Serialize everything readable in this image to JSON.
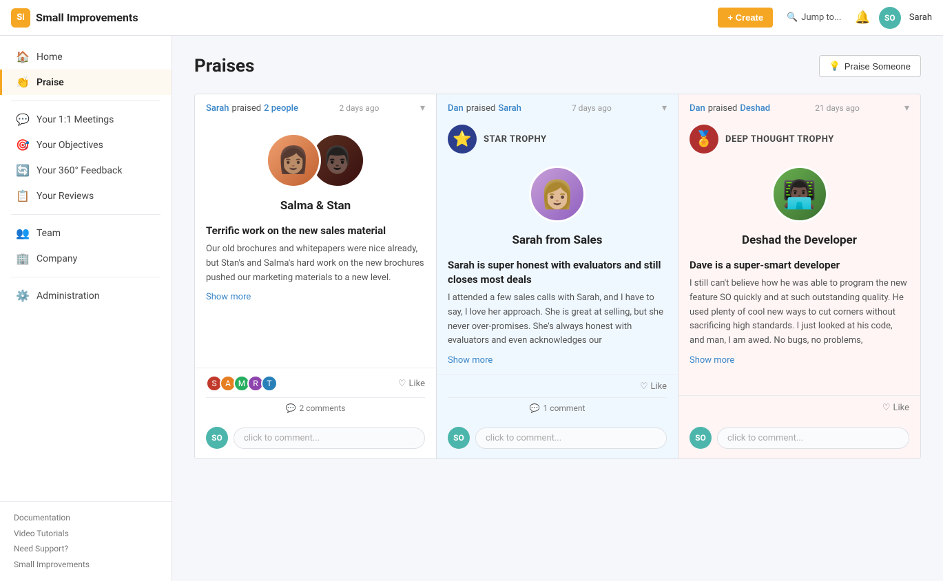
{
  "app": {
    "logo_text": "Si",
    "app_name": "Small Improvements"
  },
  "topnav": {
    "create_label": "+ Create",
    "jump_to_label": "Jump to...",
    "bell_label": "notifications",
    "user_initials": "SO",
    "user_name": "Sarah"
  },
  "sidebar": {
    "items": [
      {
        "id": "home",
        "label": "Home",
        "icon": "🏠",
        "active": false
      },
      {
        "id": "praise",
        "label": "Praise",
        "icon": "👏",
        "active": true
      },
      {
        "id": "meetings",
        "label": "Your 1:1 Meetings",
        "icon": "💬",
        "active": false
      },
      {
        "id": "objectives",
        "label": "Your Objectives",
        "icon": "🎯",
        "active": false
      },
      {
        "id": "feedback",
        "label": "Your 360° Feedback",
        "icon": "🔄",
        "active": false
      },
      {
        "id": "reviews",
        "label": "Your Reviews",
        "icon": "📋",
        "active": false
      },
      {
        "id": "team",
        "label": "Team",
        "icon": "👥",
        "active": false
      },
      {
        "id": "company",
        "label": "Company",
        "icon": "🏢",
        "active": false
      },
      {
        "id": "administration",
        "label": "Administration",
        "icon": "⚙️",
        "active": false
      }
    ],
    "footer_links": [
      "Documentation",
      "Video Tutorials",
      "Need Support?",
      "Small Improvements"
    ]
  },
  "page": {
    "title": "Praises",
    "praise_someone_label": "Praise Someone"
  },
  "cards": [
    {
      "id": "card1",
      "bg": "white",
      "by": "Sarah",
      "action": "praised",
      "target": "2 people",
      "time": "2 days ago",
      "trophy_type": "",
      "trophy_icon": "🏅",
      "trophy_label": "",
      "person_name": "Salma & Stan",
      "praise_title": "Terrific work on the new sales material",
      "praise_body": "Our old brochures and whitepapers were nice already, but Stan's and Salma's hard work on the new brochures pushed our marketing materials to a new level.",
      "show_more_label": "Show more",
      "reaction_avatars": [
        "av1",
        "av2",
        "av3",
        "av4",
        "av5"
      ],
      "like_label": "Like",
      "comments_count": "2 comments",
      "comment_placeholder": "click to comment...",
      "commenter_initials": "SO"
    },
    {
      "id": "card2",
      "bg": "blue",
      "by": "Dan",
      "action": "praised",
      "target": "Sarah",
      "time": "7 days ago",
      "trophy_type": "star",
      "trophy_icon": "⭐",
      "trophy_label": "STAR TROPHY",
      "person_name": "Sarah from Sales",
      "praise_title": "Sarah is super honest with evaluators and still closes most deals",
      "praise_body": "I attended a few sales calls with Sarah, and I have to say, I love her approach. She is great at selling, but she never over-promises. She's always honest with evaluators and even acknowledges our",
      "show_more_label": "Show more",
      "reaction_avatars": [],
      "like_label": "Like",
      "comments_count": "1 comment",
      "comment_placeholder": "click to comment...",
      "commenter_initials": "SO"
    },
    {
      "id": "card3",
      "bg": "pink",
      "by": "Dan",
      "action": "praised",
      "target": "Deshad",
      "time": "21 days ago",
      "trophy_type": "deep_thought",
      "trophy_icon": "🏅",
      "trophy_label": "DEEP THOUGHT TROPHY",
      "person_name": "Deshad the Developer",
      "praise_title": "Dave is a super-smart developer",
      "praise_body": "I still can't believe how he was able to program the new feature SO quickly and at such outstanding quality. He used plenty of cool new ways to cut corners without sacrificing high standards. I just looked at his code, and man, I am awed. No bugs, no problems,",
      "show_more_label": "Show more",
      "reaction_avatars": [],
      "like_label": "Like",
      "comments_count": "",
      "comment_placeholder": "click to comment...",
      "commenter_initials": "SO"
    }
  ]
}
